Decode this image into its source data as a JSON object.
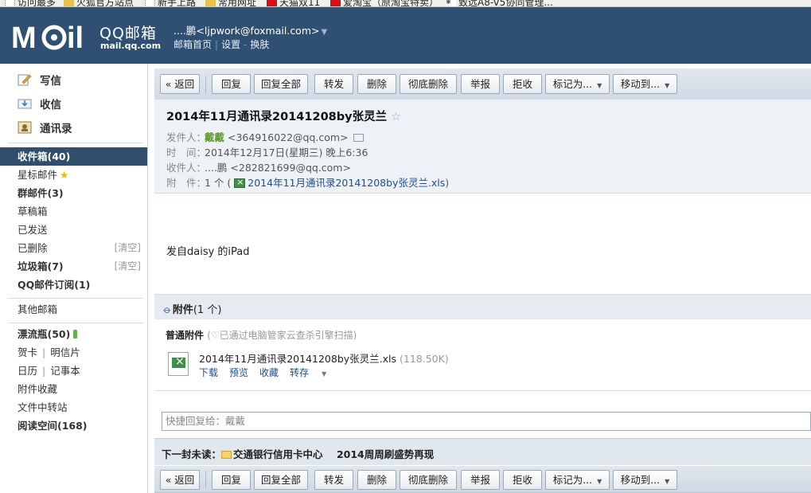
{
  "bookmarks": [
    {
      "label": "访问最多",
      "icon": "dotted"
    },
    {
      "label": "火狐官方站点",
      "icon": "folder"
    },
    {
      "label": "新手上路",
      "icon": "dotted"
    },
    {
      "label": "常用网址",
      "icon": "folder"
    },
    {
      "label": "天猫双11",
      "icon": "red"
    },
    {
      "label": "爱淘宝（原淘宝特卖）",
      "icon": "red"
    },
    {
      "label": "致远A8-V5协同管理...",
      "icon": "ct"
    }
  ],
  "header": {
    "logo_cn": "QQ邮箱",
    "logo_url": "mail.qq.com",
    "user_display": "....鹏<ljpwork@foxmail.com>",
    "links": [
      "邮箱首页",
      "设置",
      "换肤"
    ]
  },
  "sidebar": {
    "quick": [
      {
        "label": "写信",
        "icon": "compose-icon"
      },
      {
        "label": "收信",
        "icon": "inbox-icon"
      },
      {
        "label": "通讯录",
        "icon": "contacts-icon"
      }
    ],
    "folders": {
      "inbox": "收件箱(40)",
      "starred": "星标邮件",
      "group": "群邮件(3)",
      "drafts": "草稿箱",
      "sent": "已发送",
      "deleted": "已删除",
      "spam": "垃圾箱(7)",
      "subscriptions": "QQ邮件订阅(1)",
      "other": "其他邮箱",
      "bottle": "漂流瓶(50)",
      "cards": "贺卡",
      "postcards": "明信片",
      "calendar": "日历",
      "notes": "记事本",
      "attachments": "附件收藏",
      "transfer": "文件中转站",
      "reading": "阅读空间(168)",
      "clear": "[清空]"
    }
  },
  "toolbar": {
    "back": "« 返回",
    "reply": "回复",
    "reply_all": "回复全部",
    "forward": "转发",
    "delete": "删除",
    "purge": "彻底删除",
    "report": "举报",
    "reject": "拒收",
    "mark_as": "标记为...",
    "move_to": "移动到..."
  },
  "mail": {
    "subject": "2014年11月通讯录20141208by张灵兰",
    "from_label": "发件人：",
    "from_name": "戴戴",
    "from_email": "<364916022@qq.com>",
    "time_label": "时　间：",
    "time_value": "2014年12月17日(星期三) 晚上6:36",
    "to_label": "收件人：",
    "to_name": "....鹏",
    "to_email": "<282821699@qq.com>",
    "att_label": "附　件：",
    "att_count": "1 个 (",
    "att_file": "2014年11月通讯录20141208by张灵兰.xls",
    "att_close": ")",
    "body": "发自daisy 的iPad"
  },
  "attachments": {
    "title": "附件",
    "count": "(1 个)",
    "type": "普通附件",
    "scan_note": "(♡已通过电脑管家云查杀引擎扫描)",
    "file_name": "2014年11月通讯录20141208by张灵兰.xls",
    "file_size": "(118.50K)",
    "actions": {
      "download": "下载",
      "preview": "预览",
      "save": "收藏",
      "transfer": "转存"
    }
  },
  "quick_reply": {
    "placeholder": "快捷回复给：戴戴"
  },
  "next_unread": {
    "label": "下一封未读：",
    "sender": "交通银行信用卡中心",
    "subject": "2014周周刷盛势再现"
  }
}
